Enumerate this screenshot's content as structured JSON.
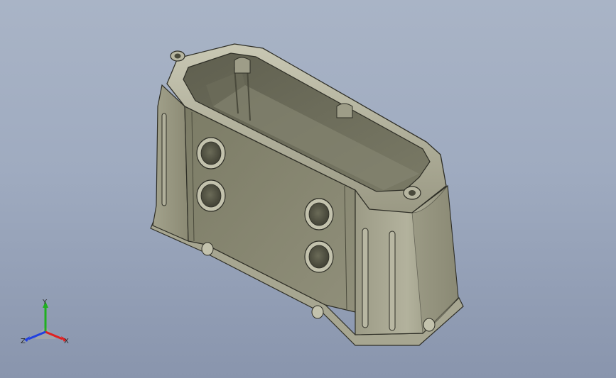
{
  "viewport": {
    "background_top": "#a9b4c6",
    "background_bottom": "#8995ad",
    "model_color": "#8a8a74"
  },
  "triad": {
    "x_label": "X",
    "y_label": "Y",
    "z_label": "Z",
    "x_color": "#e02020",
    "y_color": "#20b020",
    "z_color": "#2040e0"
  }
}
